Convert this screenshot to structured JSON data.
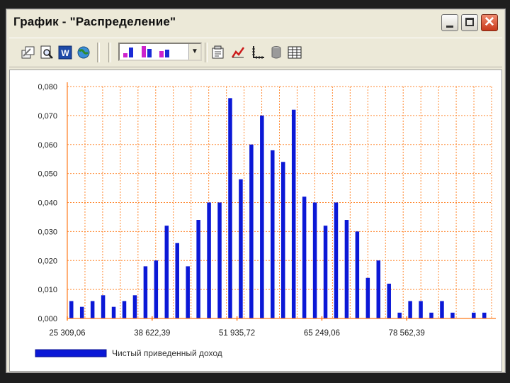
{
  "window": {
    "title": "График - \"Распределение\"",
    "controls": {
      "minimize": "minimize",
      "maximize": "maximize",
      "close": "close"
    }
  },
  "toolbar": {
    "icons": [
      "copy-icon",
      "print-preview-icon",
      "word-export-icon",
      "globe-icon",
      "chart-type-selector",
      "properties-icon",
      "trend-icon",
      "axes-icon",
      "series-icon",
      "table-icon"
    ]
  },
  "colors": {
    "bar": "#0b18d6",
    "grid": "#ff8a33",
    "axis": "#ff7a1a"
  },
  "chart_data": {
    "type": "bar",
    "title": "",
    "xlabel": "",
    "ylabel": "",
    "ylim": [
      0,
      0.08
    ],
    "yticks": [
      "0,000",
      "0,010",
      "0,020",
      "0,030",
      "0,040",
      "0,050",
      "0,060",
      "0,070",
      "0,080"
    ],
    "xtick_labels": [
      "25 309,06",
      "38 622,39",
      "51 935,72",
      "65 249,06",
      "78 562,39"
    ],
    "xlim": [
      25309.06,
      91875.72
    ],
    "grid": true,
    "legend": "bottom-left",
    "series": [
      {
        "name": "Чистый приведенный доход",
        "values": [
          0.006,
          0.004,
          0.006,
          0.008,
          0.004,
          0.006,
          0.008,
          0.018,
          0.02,
          0.032,
          0.026,
          0.018,
          0.034,
          0.04,
          0.04,
          0.076,
          0.048,
          0.06,
          0.07,
          0.058,
          0.054,
          0.072,
          0.042,
          0.04,
          0.032,
          0.04,
          0.034,
          0.03,
          0.014,
          0.02,
          0.012,
          0.002,
          0.006,
          0.006,
          0.002,
          0.006,
          0.002,
          0,
          0.002,
          0.002
        ]
      }
    ]
  }
}
